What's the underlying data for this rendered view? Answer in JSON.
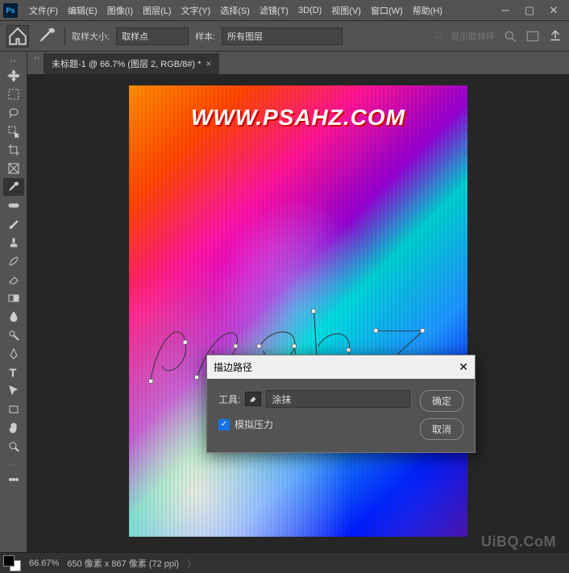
{
  "app": {
    "logo": "Ps"
  },
  "menu": {
    "file": "文件(F)",
    "edit": "编辑(E)",
    "image": "图像(I)",
    "layer": "图层(L)",
    "type": "文字(Y)",
    "select": "选择(S)",
    "filter": "滤镜(T)",
    "threeD": "3D(D)",
    "view": "视图(V)",
    "window": "窗口(W)",
    "help": "帮助(H)"
  },
  "options": {
    "sample_size_label": "取样大小:",
    "sample_size_value": "取样点",
    "sample_label": "样本:",
    "sample_value": "所有图层",
    "show_ring": "显示取样环"
  },
  "tab": {
    "title": "未标题-1 @ 66.7% (图层 2, RGB/8#) *",
    "close": "×"
  },
  "canvas": {
    "watermark": "WWW.PSAHZ.COM"
  },
  "dialog": {
    "title": "描边路径",
    "close": "✕",
    "tool_label": "工具:",
    "tool_value": "涂抹",
    "simulate_pressure": "模拟压力",
    "ok": "确定",
    "cancel": "取消"
  },
  "status": {
    "zoom": "66.67%",
    "info": "650 像素 x 867 像素 (72 ppi)",
    "arrow": "〉"
  },
  "brand": "UiBQ.CoM",
  "colors": {
    "accent": "#1473e6"
  }
}
